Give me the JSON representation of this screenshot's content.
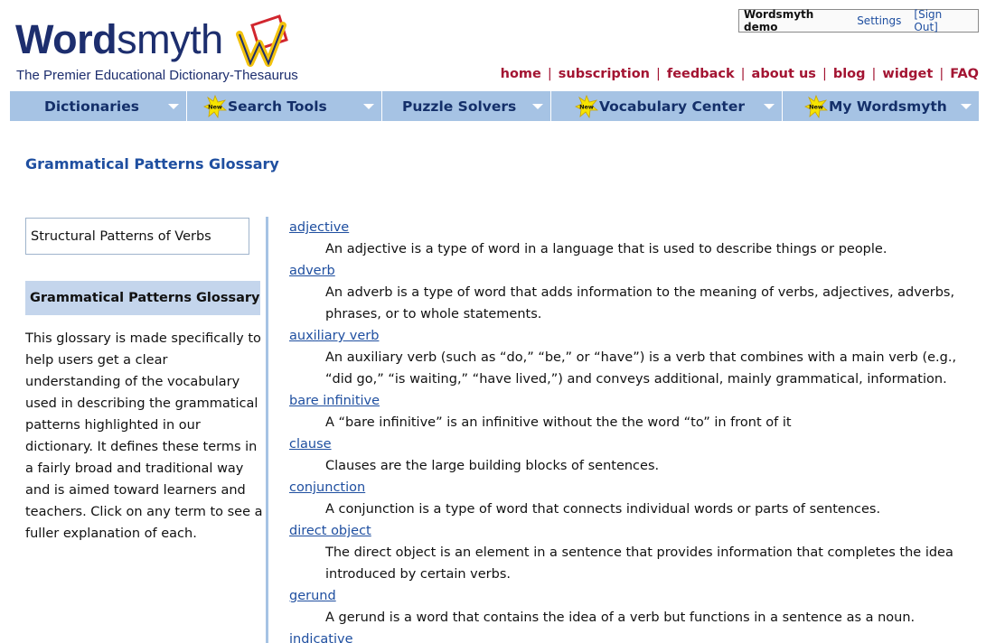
{
  "logo": {
    "word_bold": "Word",
    "word_light": "smyth",
    "tagline": "The Premier Educational Dictionary-Thesaurus"
  },
  "userbox": {
    "user": "Wordsmyth demo",
    "settings": "Settings",
    "signout": "[Sign Out]"
  },
  "toplinks": [
    "home",
    "subscription",
    "feedback",
    "about us",
    "blog",
    "widget",
    "FAQ"
  ],
  "nav": [
    {
      "label": "Dictionaries",
      "new": false
    },
    {
      "label": "Search Tools",
      "new": true
    },
    {
      "label": "Puzzle Solvers",
      "new": false
    },
    {
      "label": "Vocabulary Center",
      "new": true
    },
    {
      "label": "My Wordsmyth",
      "new": true
    }
  ],
  "new_badge": "New",
  "page_title": "Grammatical Patterns Glossary",
  "sidebar": {
    "box_label": "Structural Patterns of Verbs",
    "active_label": "Grammatical Patterns Glossary",
    "description": "This glossary is made specifically to help users get a clear understanding of the vocabulary used in describing the grammatical patterns highlighted in our dictionary. It defines these terms in a fairly broad and traditional way and is aimed toward learners and teachers. Click on any term to see a fuller explanation of each."
  },
  "glossary": [
    {
      "term": "adjective",
      "definition": "An adjective is a type of word in a language that is used to describe things or people."
    },
    {
      "term": "adverb",
      "definition": "An adverb is a type of word that adds information to the meaning of verbs, adjectives, adverbs, phrases, or to whole statements."
    },
    {
      "term": "auxiliary verb",
      "definition": "An auxiliary verb (such as “do,” “be,” or “have”) is a verb that combines with a main verb (e.g., “did go,” “is waiting,” “have lived,”) and conveys additional, mainly grammatical, information."
    },
    {
      "term": "bare infinitive",
      "definition": "A “bare infinitive” is an infinitive without the the word “to” in front of it"
    },
    {
      "term": "clause",
      "definition": "Clauses are the large building blocks of sentences."
    },
    {
      "term": "conjunction",
      "definition": "A conjunction is a type of word that connects individual words or parts of sentences."
    },
    {
      "term": "direct object",
      "definition": "The direct object is an element in a sentence that provides information that completes the idea introduced by certain verbs."
    },
    {
      "term": "gerund",
      "definition": "A gerund is a word that contains the idea of a verb but functions in a sentence as a noun."
    },
    {
      "term": "indicative",
      "definition": ""
    }
  ]
}
